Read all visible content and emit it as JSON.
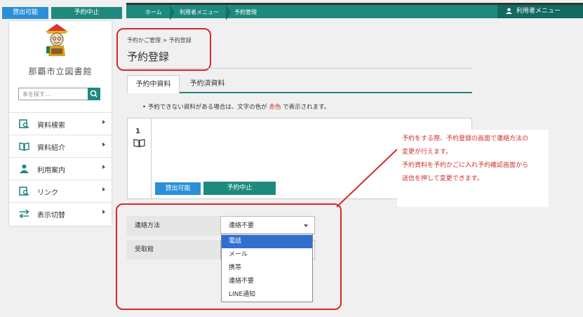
{
  "top_buttons": {
    "available": "貸出可能",
    "cancel": "予約中止"
  },
  "nav": {
    "crumbs": [
      "ホーム",
      "利用者メニュー",
      "予約管理"
    ],
    "user_menu": "利用者メニュー"
  },
  "sidebar": {
    "library_name": "那覇市立図書館",
    "search_placeholder": "本を探す…",
    "items": [
      {
        "label": "資料検索",
        "icon": "search-book-icon"
      },
      {
        "label": "資料紹介",
        "icon": "open-book-icon"
      },
      {
        "label": "利用案内",
        "icon": "person-icon"
      },
      {
        "label": "リンク",
        "icon": "link-icon"
      },
      {
        "label": "表示切替",
        "icon": "switch-arrows-icon"
      }
    ]
  },
  "page": {
    "breadcrumb": "予約かご管理 > 予約登録",
    "title": "予約登録",
    "tabs": [
      "予約中資料",
      "予約済資料"
    ],
    "note_prefix": "予約できない資料がある場合は、文字の色が",
    "note_red": "赤色",
    "note_suffix": "で表示されます。",
    "item_number": "1",
    "item_buttons": {
      "available": "貸出可能",
      "cancel": "予約中止"
    }
  },
  "form": {
    "contact_label": "連絡方法",
    "contact_value": "連絡不要",
    "pickup_label": "受取館",
    "options": [
      "電話",
      "メール",
      "携帯",
      "連絡不要",
      "LINE通知"
    ],
    "highlighted_option": "電話"
  },
  "annotation": {
    "lines": [
      "予約をする際、予約登録の画面で連絡方法の",
      "変更が行えます。",
      "予約資料を予約かごに入れ予約確認画面から",
      "送信を押して変更できます。"
    ]
  },
  "colors": {
    "teal": "#1e8a7e",
    "blue": "#2b8fd8",
    "red": "#d42a2a",
    "highlight": "#2f6fcf"
  }
}
